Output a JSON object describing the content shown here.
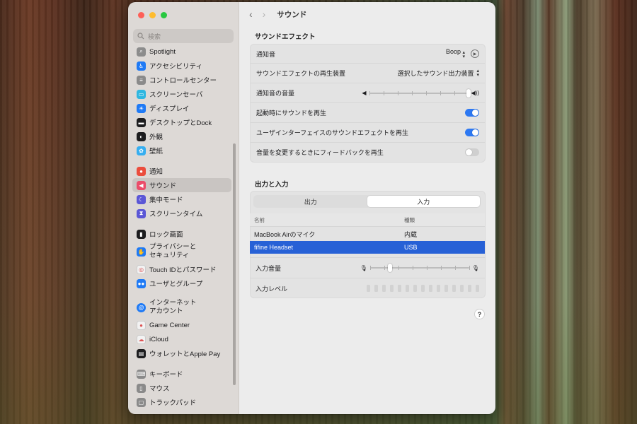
{
  "sidebar": {
    "search_placeholder": "検索",
    "items": [
      {
        "label": "Spotlight",
        "icon": "magnifier-icon",
        "color": "#8c8c8c"
      },
      {
        "label": "アクセシビリティ",
        "icon": "accessibility-icon",
        "color": "#1f7af5"
      },
      {
        "label": "コントロールセンター",
        "icon": "toggles-icon",
        "color": "#8a8a8a"
      },
      {
        "label": "スクリーンセーバ",
        "icon": "screensaver-icon",
        "color": "#2fb7e0"
      },
      {
        "label": "ディスプレイ",
        "icon": "sun-icon",
        "color": "#1f7af5"
      },
      {
        "label": "デスクトップとDock",
        "icon": "dock-icon",
        "color": "#1d1d1f"
      },
      {
        "label": "外観",
        "icon": "appearance-icon",
        "color": "#1d1d1f"
      },
      {
        "label": "壁紙",
        "icon": "flower-icon",
        "color": "#36aef0"
      },
      {
        "label": "通知",
        "icon": "bell-icon",
        "color": "#eb4d3d"
      },
      {
        "label": "サウンド",
        "icon": "speaker-icon",
        "color": "#eb4d6a"
      },
      {
        "label": "集中モード",
        "icon": "moon-icon",
        "color": "#5b57d6"
      },
      {
        "label": "スクリーンタイム",
        "icon": "hourglass-icon",
        "color": "#5b57d6"
      },
      {
        "label": "ロック画面",
        "icon": "lock-icon",
        "color": "#1d1d1f"
      },
      {
        "label": "プライバシーと\nセキュリティ",
        "icon": "hand-icon",
        "color": "#1f7af5"
      },
      {
        "label": "Touch IDとパスワード",
        "icon": "fingerprint-icon",
        "color": "#f2f2f2"
      },
      {
        "label": "ユーザとグループ",
        "icon": "users-icon",
        "color": "#1f7af5"
      },
      {
        "label": "インターネット\nアカウント",
        "icon": "at-icon",
        "color": "#1f7af5"
      },
      {
        "label": "Game Center",
        "icon": "gamecenter-icon",
        "color": "#f2f2f2"
      },
      {
        "label": "iCloud",
        "icon": "cloud-icon",
        "color": "#f2f2f2"
      },
      {
        "label": "ウォレットとApple Pay",
        "icon": "wallet-icon",
        "color": "#1d1d1f"
      },
      {
        "label": "キーボード",
        "icon": "keyboard-icon",
        "color": "#8a8a8a"
      },
      {
        "label": "マウス",
        "icon": "mouse-icon",
        "color": "#8a8a8a"
      },
      {
        "label": "トラックパッド",
        "icon": "trackpad-icon",
        "color": "#8a8a8a"
      }
    ]
  },
  "header": {
    "title": "サウンド"
  },
  "effects": {
    "title": "サウンドエフェクト",
    "alert_label": "通知音",
    "alert_value": "Boop",
    "device_label": "サウンドエフェクトの再生装置",
    "device_value": "選択したサウンド出力装置",
    "alert_volume_label": "通知音の音量",
    "alert_volume_level": 1.0,
    "startup_label": "起動時にサウンドを再生",
    "startup_on": true,
    "ui_label": "ユーザインターフェイスのサウンドエフェクトを再生",
    "ui_on": true,
    "feedback_label": "音量を変更するときにフィードバックを再生",
    "feedback_on": false
  },
  "io": {
    "title": "出力と入力",
    "tabs": [
      "出力",
      "入力"
    ],
    "selected_tab": "入力",
    "columns": [
      "名前",
      "種類"
    ],
    "rows": [
      {
        "name": "MacBook Airのマイク",
        "type": "内蔵"
      },
      {
        "name": "fifine Headset",
        "type": "USB"
      }
    ],
    "input_volume_label": "入力音量",
    "input_volume_level": 0.2,
    "input_level_label": "入力レベル",
    "input_level_segments": 15
  },
  "colors": {
    "accent": "#2d78f2",
    "selection": "#2761d6"
  }
}
